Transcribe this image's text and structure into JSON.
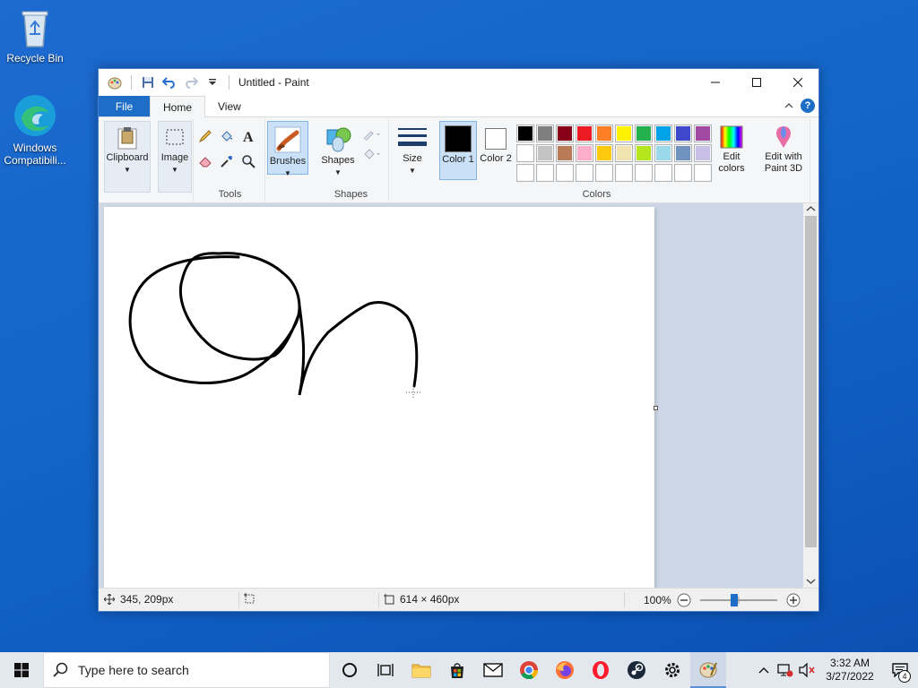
{
  "desktop": {
    "icons": [
      {
        "label": "Recycle Bin"
      },
      {
        "label": "Windows Compatibili..."
      }
    ]
  },
  "window": {
    "title": "Untitled - Paint",
    "menu": {
      "file": "File",
      "home": "Home",
      "view": "View"
    },
    "ribbon": {
      "clipboard": "Clipboard",
      "image": "Image",
      "tools_label": "Tools",
      "brushes": "Brushes",
      "shapes": "Shapes",
      "shapes_group": "Shapes",
      "size": "Size",
      "color1": "Color 1",
      "color2": "Color 2",
      "edit_colors": "Edit colors",
      "paint3d": "Edit with Paint 3D",
      "colors_group": "Colors"
    },
    "palette": {
      "row1": [
        "#000000",
        "#7f7f7f",
        "#880015",
        "#ed1c24",
        "#ff7f27",
        "#fff200",
        "#22b14c",
        "#00a2e8",
        "#3f48cc",
        "#a349a4"
      ],
      "row2": [
        "#ffffff",
        "#c3c3c3",
        "#b97a57",
        "#ffaec9",
        "#ffc90e",
        "#efe4b0",
        "#b5e61d",
        "#99d9ea",
        "#7092be",
        "#c8bfe7"
      ],
      "row3": [
        "#ffffff",
        "#ffffff",
        "#ffffff",
        "#ffffff",
        "#ffffff",
        "#ffffff",
        "#ffffff",
        "#ffffff",
        "#ffffff",
        "#ffffff"
      ]
    },
    "status": {
      "cursor": "345, 209px",
      "canvas_size": "614 × 460px",
      "zoom": "100%"
    }
  },
  "taskbar": {
    "search_placeholder": "Type here to search",
    "time": "3:32 AM",
    "date": "3/27/2022",
    "notification_count": "4"
  }
}
